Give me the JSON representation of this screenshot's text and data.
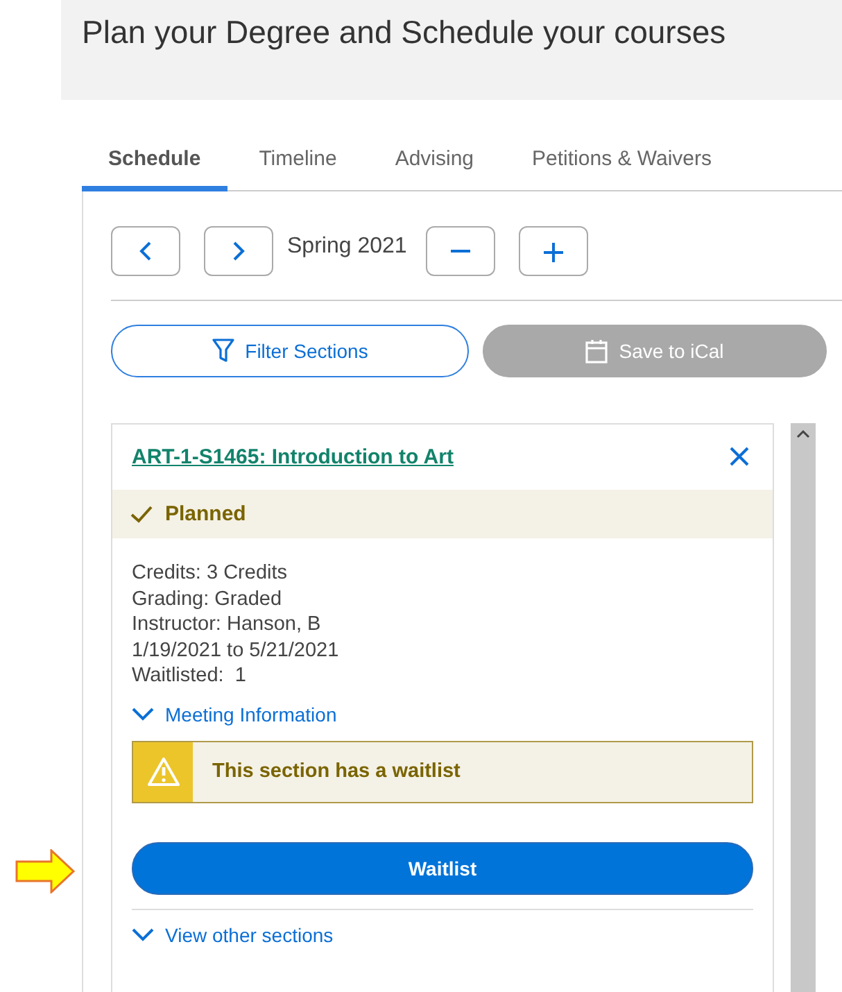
{
  "page_title": "Plan your Degree and Schedule your courses",
  "tabs": [
    {
      "label": "Schedule",
      "selected": true
    },
    {
      "label": "Timeline",
      "selected": false
    },
    {
      "label": "Advising",
      "selected": false
    },
    {
      "label": "Petitions & Waivers",
      "selected": false
    }
  ],
  "term": "Spring 2021",
  "actions": [
    {
      "label": "Filter Sections",
      "kind": "filter",
      "disabled": false
    },
    {
      "label": "Save to iCal",
      "kind": "calendar",
      "disabled": true
    }
  ],
  "course": {
    "title": "ART-1-S1465: Introduction to Art",
    "status": "Planned",
    "details": [
      "Credits: 3 Credits",
      "Grading: Graded",
      "Instructor: Hanson, B",
      "1/19/2021 to 5/21/2021",
      "Waitlisted:  1"
    ],
    "meeting_link": "Meeting Information",
    "alert": "This section has a waitlist",
    "button": "Waitlist",
    "other_link": "View other sections"
  }
}
